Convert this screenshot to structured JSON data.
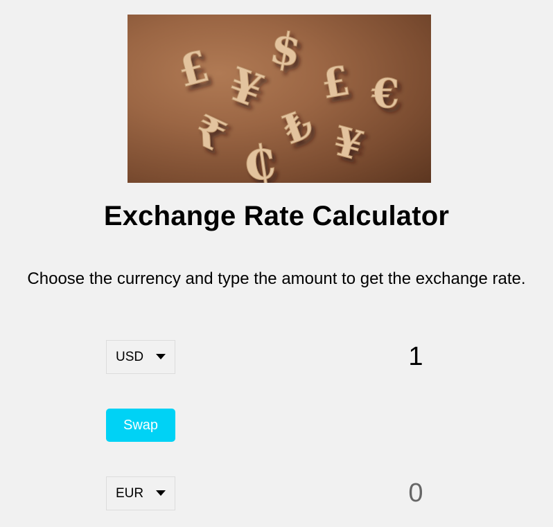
{
  "hero": {
    "image_icon": "currency-symbols-image",
    "symbols": [
      "£",
      "¥",
      "$",
      "£",
      "€",
      "₹",
      "₺",
      "¥",
      "₵"
    ]
  },
  "header": {
    "title": "Exchange Rate Calculator",
    "subtitle": "Choose the currency and type the amount to get the exchange rate."
  },
  "converter": {
    "from_currency": "USD",
    "from_amount": "1",
    "swap_label": "Swap",
    "to_currency": "EUR",
    "to_amount": "0"
  },
  "colors": {
    "background": "#f1f1f1",
    "accent": "#00d2f5",
    "result_text": "#666666"
  }
}
